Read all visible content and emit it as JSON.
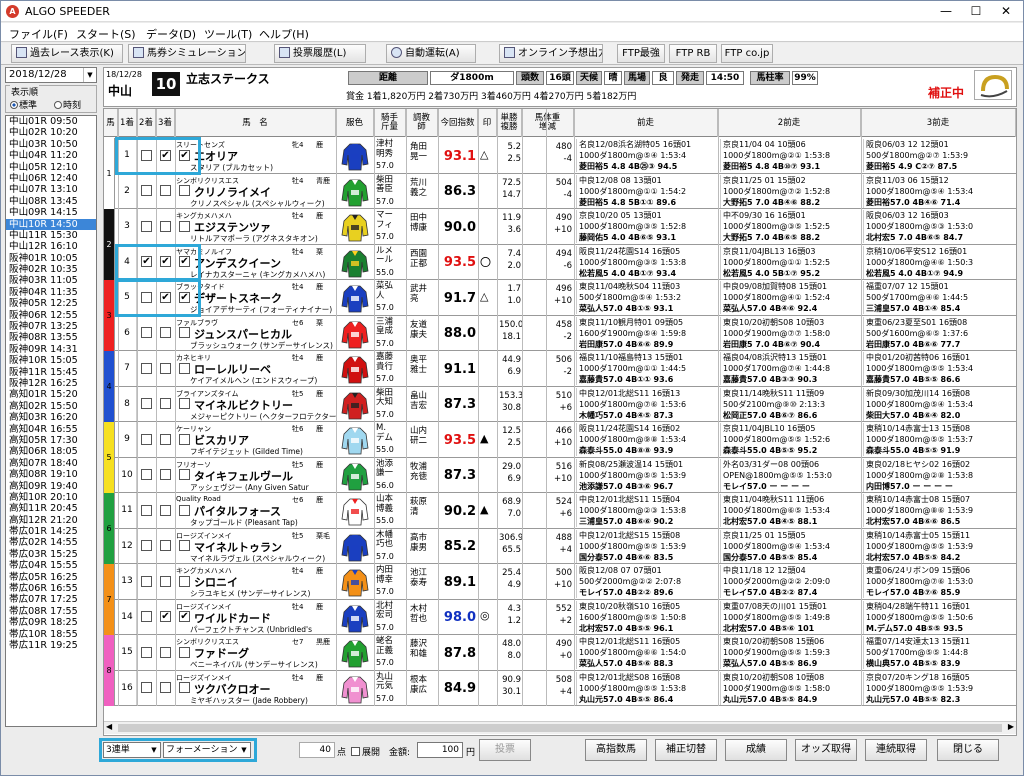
{
  "window": {
    "title": "ALGO SPEEDER",
    "minimize": "—",
    "maximize": "☐",
    "close": "✕"
  },
  "menu": [
    "ファイル(F)",
    "スタート(S)",
    "データ(D)",
    "ツール(T)",
    "ヘルプ(H)"
  ],
  "toolbar": [
    "過去レース表示(K)",
    "馬券シミュレーション(B)",
    "投票履歴(L)",
    "自動運転(A)",
    "オンライン予想出力",
    "FTP最強",
    "FTP RB",
    "FTP co.jp"
  ],
  "date": "2018/12/28",
  "display_order": {
    "label": "表示順",
    "opt1": "標準",
    "opt2": "時刻"
  },
  "races": [
    "中山01R 09:50",
    "中山02R 10:20",
    "中山03R 10:50",
    "中山04R 11:20",
    "中山05R 12:10",
    "中山06R 12:40",
    "中山07R 13:10",
    "中山08R 13:45",
    "中山09R 14:15",
    "中山10R 14:50",
    "中山11R 15:30",
    "中山12R 16:10",
    "阪神01R 10:05",
    "阪神02R 10:35",
    "阪神03R 11:05",
    "阪神04R 11:35",
    "阪神05R 12:25",
    "阪神06R 12:55",
    "阪神07R 13:25",
    "阪神08R 13:55",
    "阪神09R 14:31",
    "阪神10R 15:05",
    "阪神11R 15:45",
    "阪神12R 16:25",
    "高知01R 15:20",
    "高知02R 15:50",
    "高知03R 16:20",
    "高知04R 16:55",
    "高知05R 17:30",
    "高知06R 18:05",
    "高知07R 18:40",
    "高知08R 19:10",
    "高知09R 19:40",
    "高知10R 20:10",
    "高知11R 20:45",
    "高知12R 21:20",
    "帯広01R 14:25",
    "帯広02R 14:55",
    "帯広03R 15:25",
    "帯広04R 15:55",
    "帯広05R 16:25",
    "帯広06R 16:55",
    "帯広07R 17:25",
    "帯広08R 17:55",
    "帯広09R 18:25",
    "帯広10R 18:55",
    "帯広11R 19:25"
  ],
  "race": {
    "date": "18/12/28",
    "venue": "中山",
    "num": "10",
    "name": "立志ステークス",
    "dist_label": "距離",
    "dist": "ダ1800m",
    "heads_label": "頭数",
    "heads": "16頭",
    "weather_label": "天候",
    "weather": "晴",
    "track_label": "馬場",
    "track": "良",
    "post_label": "発走",
    "post": "14:50",
    "conf_label": "馬柱率",
    "conf": "99%",
    "prize": "賞金 1着1,820万円 2着730万円 3着460万円 4着270万円 5着182万円",
    "status": "補正中"
  },
  "columns": [
    "馬",
    "1着",
    "2着",
    "3着",
    "馬　名",
    "服色",
    "騎手\n斤量",
    "調教\n師",
    "今回指数",
    "印",
    "単勝\n複勝",
    "馬体重\n増減",
    "前走",
    "2前走",
    "3前走"
  ],
  "horses": [
    {
      "frame": "1",
      "num": "1",
      "c1": false,
      "c2": true,
      "c3": true,
      "sire": "スリートセンズ",
      "sex": "牝4",
      "color": "鹿",
      "name": "エオリア",
      "dam": "スタリア (ブルカセット)",
      "jockey": "津村\n明秀",
      "weight": "57.0",
      "trainer": "角田\n晃一",
      "index": "93.1",
      "mark": "△",
      "odds1": "5.2",
      "odds2": "2.5",
      "bw": "480",
      "bwd": "-4",
      "prev": [
        "名良12/08浜名湖特05 16頭01",
        "1000ダ1800m@⑤④ 1:53:4",
        "菱田裕5 4.8 4B㉕③ 94.5"
      ],
      "prev2": [
        "京良11/04 04 10頭06",
        "1000ダ1800m@②① 1:53:8",
        "菱田裕5 4.8 4B⑩⑦ 93.1"
      ],
      "prev3": [
        "阪良06/03 12 12頭01",
        "500ダ1800m@②⑦ 1:53:9",
        "菱田裕5 4.9 C②⑦ 87.5"
      ]
    },
    {
      "frame": "1",
      "num": "2",
      "c1": false,
      "c2": false,
      "c3": false,
      "sire": "シンボリクリスエス",
      "sex": "牡4",
      "color": "青鹿",
      "name": "クリノライメイ",
      "dam": "クリノスペシャル (スペシャルウィーク)",
      "jockey": "柴田\n善臣",
      "weight": "57.0",
      "trainer": "荒川\n義之",
      "index": "86.3",
      "mark": "",
      "odds1": "72.5",
      "odds2": "14.7",
      "bw": "504",
      "bwd": "-4",
      "prev": [
        "中良12/08 08 13頭01",
        "1000ダ1800m@①① 1:54:2",
        "菱田裕5 4.8 5B①① 89.6"
      ],
      "prev2": [
        "京良11/25 01 15頭02",
        "1000ダ1800m@⑦② 1:52:8",
        "大野拓5 7.0 4B④⑥ 88.2"
      ],
      "prev3": [
        "京良11/03 06 15頭12",
        "1000ダ1800m@⑤④ 1:53:4",
        "菱田裕57.0 4B④⑥ 71.4"
      ]
    },
    {
      "frame": "2",
      "num": "3",
      "c1": false,
      "c2": false,
      "c3": false,
      "sire": "キングカメハメハ",
      "sex": "牡4",
      "color": "鹿",
      "name": "エジステンツァ",
      "dam": "リトルアマポーラ (アグネスタキオン)",
      "jockey": "マー\nフィ",
      "weight": "57.0",
      "trainer": "田中\n博康",
      "index": "90.0",
      "mark": "",
      "odds1": "11.9",
      "odds2": "3.6",
      "bw": "490",
      "bwd": "+10",
      "prev": [
        "京良10/20 05 13頭01",
        "1000ダ1800m@③⑤ 1:52:8",
        "藤岡佑5 4.0 4B⑥⑤ 93.1"
      ],
      "prev2": [
        "中不09/30 16 16頭01",
        "1000ダ1800m@③⑤ 1:52:5",
        "大野拓5 7.0 4B⑥⑤ 88.2"
      ],
      "prev3": [
        "阪良06/03 12 16頭03",
        "1000ダ1800m@⑤③ 1:53:0",
        "北村宏5 7.0 4B⑥⑤ 84.7"
      ]
    },
    {
      "frame": "2",
      "num": "4",
      "c1": true,
      "c2": true,
      "c3": true,
      "sire": "ヤマカミノルイフ",
      "sex": "牡4",
      "color": "栗",
      "name": "アンデスクイーン",
      "dam": "レイナカスターニャ (キングカメハメハ)",
      "jockey": "ルメ\nール",
      "weight": "55.0",
      "trainer": "西園\n正都",
      "index": "93.5",
      "mark": "〇",
      "odds1": "7.4",
      "odds2": "2.0",
      "bw": "494",
      "bwd": "-6",
      "prev": [
        "阪良11/24花園S14 16頭05",
        "1000ダ1800m@③⑤ 1:53:8",
        "松若風5 4.0 4B①⑦ 93.4"
      ],
      "prev2": [
        "京良11/04JBL13 16頭03",
        "1000ダ1800m@①① 1:52:5",
        "松若風5 4.0 5B①⑦ 95.2"
      ],
      "prev3": [
        "京稍10/06平安S12 16頭01",
        "1000ダ1800m@④⑥ 1:50:3",
        "松若風5 4.0 4B①⑦ 94.9"
      ]
    },
    {
      "frame": "3",
      "num": "5",
      "c1": false,
      "c2": true,
      "c3": true,
      "sire": "ブラックタイド",
      "sex": "牡4",
      "color": "鹿",
      "name": "デザートスネーク",
      "dam": "ジョイアデサーティ (フォーティナイナー)",
      "jockey": "菜弘\n人",
      "weight": "57.0",
      "trainer": "武井\n亮",
      "index": "91.7",
      "mark": "△",
      "odds1": "1.7",
      "odds2": "1.0",
      "bw": "496",
      "bwd": "+10",
      "prev": [
        "東良11/04晩秋S04 11頭03",
        "500ダ1800m@⑤④ 1:53:2",
        "菜弘人57.0 4B①⑤ 93.1"
      ],
      "prev2": [
        "中良09/08加賀特08 15頭01",
        "1000ダ1800m@④① 1:52:4",
        "菜弘人57.0 4B④⑥ 92.4"
      ],
      "prev3": [
        "福重07/07 12 15頭01",
        "500ダ1700m@④⑥ 1:44:5",
        "三浦皇57.0 4B①④ 85.4"
      ]
    },
    {
      "frame": "3",
      "num": "6",
      "c1": false,
      "c2": false,
      "c3": false,
      "sire": "ファルブラヴ",
      "sex": "セ6",
      "color": "栗",
      "name": "ジュンスパーヒカル",
      "dam": "ブラッシュウォーク (サンデーサイレンス)",
      "jockey": "三浦\n皇成",
      "weight": "57.0",
      "trainer": "友道\n康夫",
      "index": "88.0",
      "mark": "",
      "odds1": "150.0",
      "odds2": "18.1",
      "bw": "458",
      "bwd": "-2",
      "prev": [
        "東良11/10観月特01 09頭05",
        "1600ダ1900m@⑤④ 1:59:8",
        "岩田康57.0 4B⑥⑥ 89.9"
      ],
      "prev2": [
        "東良10/20初朝S08 10頭03",
        "1000ダ1900m@⑦⑦ 1:58:0",
        "岩田康5 7.0 4B⑥⑦ 90.4"
      ],
      "prev3": [
        "東重06/23夏至S01 16頭08",
        "500ダ1600m@⑥⑤ 1:37:6",
        "岩田康57.0 4B⑥⑥ 77.7"
      ]
    },
    {
      "frame": "4",
      "num": "7",
      "c1": false,
      "c2": false,
      "c3": false,
      "sire": "カネヒキリ",
      "sex": "牡4",
      "color": "鹿",
      "name": "ローレルリーベ",
      "dam": "ケイアイメルヘン (エンドスウィープ)",
      "jockey": "嘉藤\n貴行",
      "weight": "57.0",
      "trainer": "奥平\n雅士",
      "index": "91.1",
      "mark": "",
      "odds1": "44.9",
      "odds2": "6.9",
      "bw": "506",
      "bwd": "-2",
      "prev": [
        "福良11/10福島特13 15頭01",
        "1000ダ1700m@①① 1:44:5",
        "嘉藤貴57.0 4B①① 93.6"
      ],
      "prev2": [
        "福良04/08浜沢特13 15頭01",
        "1000ダ1700m@⑦④ 1:44:8",
        "嘉藤貴57.0 4B③③ 90.3"
      ],
      "prev3": [
        "中良01/20初茜特06 16頭01",
        "1000ダ1800m@⑤⑤ 1:53:4",
        "嘉藤貴57.0 4B⑤⑤ 86.6"
      ]
    },
    {
      "frame": "4",
      "num": "8",
      "c1": false,
      "c2": false,
      "c3": false,
      "sire": "ブライアンズタイム",
      "sex": "牡5",
      "color": "鹿",
      "name": "マイネルビクトリー",
      "dam": "メジャーピクトリー (ヘクターフロテクター)",
      "jockey": "柴田\n大知",
      "weight": "57.0",
      "trainer": "畠山\n吉宏",
      "index": "87.3",
      "mark": "",
      "odds1": "153.3",
      "odds2": "30.8",
      "bw": "510",
      "bwd": "+6",
      "prev": [
        "中良12/01北総S11 16頭13",
        "1000ダ1800m@⑦⑥ 1:53:6",
        "木幡巧57.0 4B④⑤ 87.3"
      ],
      "prev2": [
        "東良11/14晩秋S11 11頭09",
        "500ダ2100m@⑨⑩ 2:13:3",
        "松岡正57.0 4B⑥⑦ 86.6"
      ],
      "prev3": [
        "新良09/30加茂川14 16頭08",
        "1000ダ1800m@⑤④ 1:53:4",
        "柴田大57.0 4B⑥④ 82.0"
      ]
    },
    {
      "frame": "5",
      "num": "9",
      "c1": false,
      "c2": false,
      "c3": false,
      "sire": "ケーリャン",
      "sex": "牡6",
      "color": "鹿",
      "name": "ビスカリア",
      "dam": "フギイテジェット (Gilded Time)",
      "jockey": "M.\nデム",
      "weight": "55.0",
      "trainer": "山内\n研二",
      "index": "93.5",
      "mark": "▲",
      "odds1": "12.5",
      "odds2": "2.5",
      "bw": "466",
      "bwd": "+10",
      "prev": [
        "阪良11/24花園S14 16頭02",
        "1000ダ1800m@⑨⑧ 1:53:4",
        "森泰斗55.0 4B⑧⑧ 93.9"
      ],
      "prev2": [
        "京良11/04JBL10 16頭05",
        "1000ダ1800m@⑤⑤ 1:52:6",
        "森泰斗55.0 4B⑤⑤ 95.2"
      ],
      "prev3": [
        "東稍10/14赤富士13 15頭08",
        "1000ダ1800m@⑤⑤ 1:53:7",
        "森泰斗55.0 4B⑤⑤ 91.9"
      ]
    },
    {
      "frame": "5",
      "num": "10",
      "c1": false,
      "c2": false,
      "c3": false,
      "sire": "フリオーソ",
      "sex": "牡5",
      "color": "鹿",
      "name": "タイキフェルヴール",
      "dam": "アッシェヴジー (Any Given Satur",
      "jockey": "池添\n謙一",
      "weight": "56.0",
      "trainer": "牧浦\n充徳",
      "index": "87.3",
      "mark": "",
      "odds1": "29.0",
      "odds2": "6.9",
      "bw": "516",
      "bwd": "+10",
      "prev": [
        "新良08/25瀬波温14 15頭01",
        "1000ダ1800m@⑤⑤ 1:53:9",
        "池添謙57.0 4B③⑥ 96.7"
      ],
      "prev2": [
        "外名03/31ダー08 00頭06",
        "OPEN@1800m@⑤⑤ 1:53:0",
        "モレイ57.0 ー ー ー ー"
      ],
      "prev3": [
        "東良02/18ヒヤシ02 16頭02",
        "1000ダ1800m@②⑧ 1:53:8",
        "内田博57.0 ー ー ー ー"
      ]
    },
    {
      "frame": "6",
      "num": "11",
      "c1": false,
      "c2": false,
      "c3": false,
      "sire": "Quality Road",
      "sex": "セ6",
      "color": "鹿",
      "name": "パイタルフォース",
      "dam": "タップゴールド (Pleasant Tap)",
      "jockey": "山本\n博義",
      "weight": "55.0",
      "trainer": "萩原\n清",
      "index": "90.2",
      "mark": "▲",
      "odds1": "68.9",
      "odds2": "7.0",
      "bw": "524",
      "bwd": "+6",
      "prev": [
        "中良12/01北総S11 15頭04",
        "1000ダ1800m@②③ 1:53:8",
        "三浦皇57.0 4B⑥⑥ 90.2"
      ],
      "prev2": [
        "東良11/04晩秋S11 11頭06",
        "1000ダ1800m@⑥⑤ 1:53:4",
        "北村宏57.0 4B④⑤ 88.1"
      ],
      "prev3": [
        "東稍10/14赤富士08 15頭07",
        "1000ダ1800m@⑧⑥ 1:53:9",
        "北村宏57.0 4B⑥⑥ 86.5"
      ]
    },
    {
      "frame": "6",
      "num": "12",
      "c1": false,
      "c2": false,
      "c3": false,
      "sire": "ロージズインメイ",
      "sex": "牡5",
      "color": "栗毛",
      "name": "マイネルトゥラン",
      "dam": "マイネルラヴェル (スペシャルウィーク)",
      "jockey": "木幡\n巧也",
      "weight": "57.0",
      "trainer": "高市\n康男",
      "index": "85.2",
      "mark": "",
      "odds1": "306.9",
      "odds2": "65.5",
      "bw": "488",
      "bwd": "+4",
      "prev": [
        "中良12/01北総S15 15頭08",
        "1000ダ1800m@⑤⑤ 1:53:9",
        "国分泰57.0 4B⑥⑥ 83.5"
      ],
      "prev2": [
        "京良11/25 01 15頭05",
        "1000ダ1800m@⑤④ 1:53:4",
        "国分泰57.0 4B⑤⑤ 85.4"
      ],
      "prev3": [
        "東稍10/14赤富士05 15頭11",
        "1000ダ1800m@⑤⑤ 1:53:9",
        "北村宏57.0 4B⑤⑤ 84.2"
      ]
    },
    {
      "frame": "7",
      "num": "13",
      "c1": false,
      "c2": false,
      "c3": false,
      "sire": "キングカメハメハ",
      "sex": "牡4",
      "color": "鹿",
      "name": "シロニイ",
      "dam": "シラユキヒメ (サンデーサイレンス)",
      "jockey": "内田\n博幸",
      "weight": "57.0",
      "trainer": "池江\n泰寿",
      "index": "89.1",
      "mark": "",
      "odds1": "25.4",
      "odds2": "4.9",
      "bw": "500",
      "bwd": "+10",
      "prev": [
        "阪良12/08 07 07頭01",
        "500ダ2000m@②② 2:07:8",
        "モレイ57.0 4B②② 89.6"
      ],
      "prev2": [
        "中良11/18 12 12頭04",
        "1000ダ2000m@②② 2:09:0",
        "モレイ57.0 4B②② 87.4"
      ],
      "prev3": [
        "東重06/24リボン09 15頭06",
        "1000ダ1800m@⑦⑥ 1:53:0",
        "モレイ57.0 4B⑦⑥ 85.9"
      ]
    },
    {
      "frame": "7",
      "num": "14",
      "c1": false,
      "c2": true,
      "c3": true,
      "sire": "ロージズインメイ",
      "sex": "牡4",
      "color": "鹿",
      "name": "ワイルドカード",
      "dam": "パーフェクトチャンス (Unbridled's",
      "jockey": "北村\n宏司",
      "weight": "57.0",
      "trainer": "木村\n哲也",
      "index": "98.0",
      "mark": "◎",
      "odds1": "4.3",
      "odds2": "1.2",
      "bw": "552",
      "bwd": "+2",
      "prev": [
        "東良10/20秋嶺S10 16頭05",
        "1600ダ1800m@⑤⑤ 1:50:8",
        "北村宏57.0 4B⑤⑤ 96.1"
      ],
      "prev2": [
        "東重07/08天の川01 15頭01",
        "1000ダ1800m@⑤⑤ 1:49:8",
        "北村宏57.0 4B⑤⑥ 101"
      ],
      "prev3": [
        "東稍04/28端午特11 16頭01",
        "1000ダ1800m@⑤⑤ 1:50:6",
        "M.デム57.0 4B⑤⑤ 93.5"
      ]
    },
    {
      "frame": "8",
      "num": "15",
      "c1": false,
      "c2": false,
      "c3": false,
      "sire": "シンボリクリスエス",
      "sex": "セ7",
      "color": "黒鹿",
      "name": "ファドーグ",
      "dam": "ベニーネイバル (サンデーサイレンス)",
      "jockey": "蛯名\n正義",
      "weight": "57.0",
      "trainer": "藤沢\n和雄",
      "index": "87.8",
      "mark": "",
      "odds1": "48.0",
      "odds2": "8.0",
      "bw": "490",
      "bwd": "+0",
      "prev": [
        "中良12/01北総S11 16頭05",
        "1000ダ1800m@⑥⑥ 1:54:0",
        "菜弘人57.0 4B⑤⑥ 88.3"
      ],
      "prev2": [
        "東良10/20初朝S08 15頭06",
        "1000ダ1900m@⑤⑤ 1:59:3",
        "菜弘人57.0 4B⑤⑤ 86.9"
      ],
      "prev3": [
        "福重07/14安達太13 15頭11",
        "500ダ1700m@⑤⑤ 1:44:8",
        "横山典57.0 4B⑤⑤ 83.9"
      ]
    },
    {
      "frame": "8",
      "num": "16",
      "c1": false,
      "c2": false,
      "c3": false,
      "sire": "ロージズインメイ",
      "sex": "牡4",
      "color": "鹿",
      "name": "ツクバクロオー",
      "dam": "ミヤギハッスター (Jade Robbery)",
      "jockey": "丸山\n元気",
      "weight": "57.0",
      "trainer": "根本\n康広",
      "index": "84.9",
      "mark": "",
      "odds1": "90.9",
      "odds2": "30.1",
      "bw": "508",
      "bwd": "+4",
      "prev": [
        "中良12/01北総S08 16頭08",
        "1000ダ1800m@⑤⑤ 1:53:8",
        "丸山元57.0 4B⑤⑤ 86.4"
      ],
      "prev2": [
        "東良10/20初朝S08 10頭08",
        "1000ダ1900m@⑤⑤ 1:58:0",
        "丸山元57.0 4B⑤⑤ 84.9"
      ],
      "prev3": [
        "京良07/20キング18 16頭05",
        "1000ダ1800m@⑤⑤ 1:53:9",
        "丸山元57.0 4B⑤⑤ 82.3"
      ]
    }
  ],
  "bottom": {
    "bettype": "3連単",
    "formation": "フォーメーション",
    "points": "40",
    "points_unit": "点",
    "expand": "展開",
    "amount_label": "金額:",
    "amount": "100",
    "amount_unit": "円",
    "vote": "投票",
    "buttons": [
      "高指数馬",
      "補正切替",
      "成績",
      "オッズ取得",
      "連続取得",
      "閉じる"
    ]
  },
  "colors": {
    "frame1": "#ffffff",
    "frame2": "#000000",
    "frame3": "#ee2020",
    "frame4": "#2050d0",
    "frame5": "#f6e020",
    "frame6": "#20a040",
    "frame7": "#f39018",
    "frame8": "#f060c0",
    "highlight": "#2ea8d8",
    "selected": "#3c86d8"
  }
}
